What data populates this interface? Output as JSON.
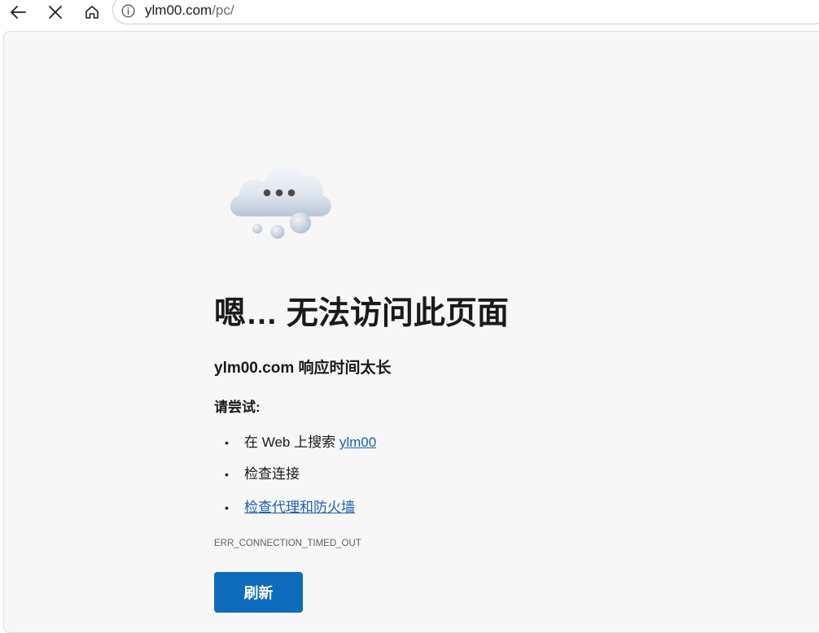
{
  "browser": {
    "url_host": "ylm00.com",
    "url_path": "/pc/",
    "icons": {
      "back": "arrow-left-icon",
      "stop": "close-icon",
      "home": "home-icon",
      "site_info": "info-icon"
    }
  },
  "error_page": {
    "title": "嗯… 无法访问此页面",
    "subtitle": "ylm00.com 响应时间太长",
    "try_label": "请尝试:",
    "suggestions": [
      {
        "prefix": "在 Web 上搜索 ",
        "link": "ylm00"
      },
      {
        "prefix": "检查连接",
        "link": ""
      },
      {
        "prefix": "",
        "link": "检查代理和防火墙"
      }
    ],
    "error_code": "ERR_CONNECTION_TIMED_OUT",
    "refresh_label": "刷新",
    "illustration": "cloud-icon"
  },
  "colors": {
    "accent": "#0f6cbd",
    "link": "#1a5fb4",
    "page_background": "#f7f7f7"
  }
}
